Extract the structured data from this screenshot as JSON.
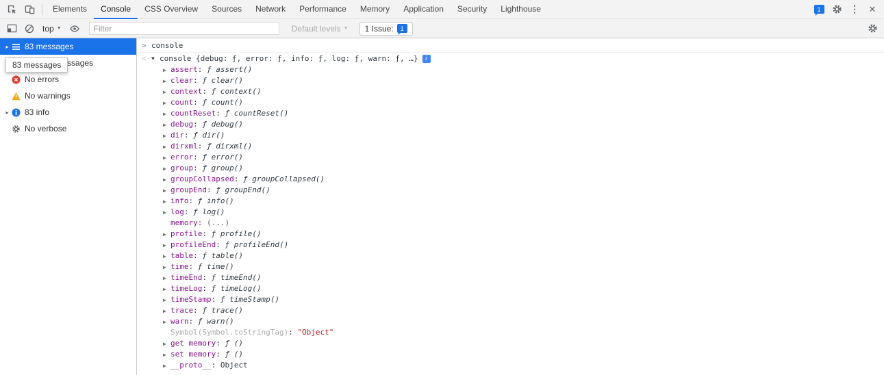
{
  "window": {
    "tabs": [
      "Elements",
      "Console",
      "CSS Overview",
      "Sources",
      "Network",
      "Performance",
      "Memory",
      "Application",
      "Security",
      "Lighthouse"
    ],
    "active_tab": "Console",
    "issues_badge": "1"
  },
  "toolbar": {
    "context": "top",
    "filter_placeholder": "Filter",
    "levels": "Default levels",
    "issue_text": "1 Issue:",
    "issue_count": "1"
  },
  "icons": {
    "inspect": "cursor-in-box",
    "device_toolbar": "phone-tablet",
    "issues": "speech-bubble",
    "settings": "gear",
    "menu": "kebab-dots",
    "close": "x",
    "sidebar_toggle": "panel-square",
    "clear_console": "slashed-circle",
    "live_expression": "eye",
    "messages": "list-lines",
    "user_messages": "person",
    "errors": "red-circle-x",
    "warnings": "yellow-triangle-exclaim",
    "info": "blue-circle-i",
    "verbose": "gear"
  },
  "sidebar": {
    "tooltip": "83 messages",
    "items": [
      {
        "label": "83 messages",
        "icon": "messages",
        "selected": true,
        "expandable": true
      },
      {
        "label": "No user messages",
        "icon": "user_messages"
      },
      {
        "label": "No errors",
        "icon": "errors"
      },
      {
        "label": "No warnings",
        "icon": "warnings"
      },
      {
        "label": "83 info",
        "icon": "info",
        "expandable": true
      },
      {
        "label": "No verbose",
        "icon": "verbose"
      }
    ]
  },
  "console": {
    "command": "console",
    "result": {
      "preview": "console {debug: ƒ, error: ƒ, info: ƒ, log: ƒ, warn: ƒ, …}",
      "expanded": true
    },
    "properties": [
      {
        "name": "assert",
        "value": "ƒ assert()",
        "kind": "function",
        "expandable": true
      },
      {
        "name": "clear",
        "value": "ƒ clear()",
        "kind": "function",
        "expandable": true
      },
      {
        "name": "context",
        "value": "ƒ context()",
        "kind": "function",
        "expandable": true
      },
      {
        "name": "count",
        "value": "ƒ count()",
        "kind": "function",
        "expandable": true
      },
      {
        "name": "countReset",
        "value": "ƒ countReset()",
        "kind": "function",
        "expandable": true
      },
      {
        "name": "debug",
        "value": "ƒ debug()",
        "kind": "function",
        "expandable": true
      },
      {
        "name": "dir",
        "value": "ƒ dir()",
        "kind": "function",
        "expandable": true
      },
      {
        "name": "dirxml",
        "value": "ƒ dirxml()",
        "kind": "function",
        "expandable": true
      },
      {
        "name": "error",
        "value": "ƒ error()",
        "kind": "function",
        "expandable": true
      },
      {
        "name": "group",
        "value": "ƒ group()",
        "kind": "function",
        "expandable": true
      },
      {
        "name": "groupCollapsed",
        "value": "ƒ groupCollapsed()",
        "kind": "function",
        "expandable": true
      },
      {
        "name": "groupEnd",
        "value": "ƒ groupEnd()",
        "kind": "function",
        "expandable": true
      },
      {
        "name": "info",
        "value": "ƒ info()",
        "kind": "function",
        "expandable": true
      },
      {
        "name": "log",
        "value": "ƒ log()",
        "kind": "function",
        "expandable": true
      },
      {
        "name": "memory",
        "value": "(...)",
        "kind": "accessor"
      },
      {
        "name": "profile",
        "value": "ƒ profile()",
        "kind": "function",
        "expandable": true
      },
      {
        "name": "profileEnd",
        "value": "ƒ profileEnd()",
        "kind": "function",
        "expandable": true
      },
      {
        "name": "table",
        "value": "ƒ table()",
        "kind": "function",
        "expandable": true
      },
      {
        "name": "time",
        "value": "ƒ time()",
        "kind": "function",
        "expandable": true
      },
      {
        "name": "timeEnd",
        "value": "ƒ timeEnd()",
        "kind": "function",
        "expandable": true
      },
      {
        "name": "timeLog",
        "value": "ƒ timeLog()",
        "kind": "function",
        "expandable": true
      },
      {
        "name": "timeStamp",
        "value": "ƒ timeStamp()",
        "kind": "function",
        "expandable": true
      },
      {
        "name": "trace",
        "value": "ƒ trace()",
        "kind": "function",
        "expandable": true
      },
      {
        "name": "warn",
        "value": "ƒ warn()",
        "kind": "function",
        "expandable": true
      },
      {
        "name": "Symbol(Symbol.toStringTag)",
        "value": "\"Object\"",
        "kind": "string",
        "dim": true
      },
      {
        "name": "get memory",
        "value": "ƒ ()",
        "kind": "function",
        "expandable": true
      },
      {
        "name": "set memory",
        "value": "ƒ ()",
        "kind": "function",
        "expandable": true
      },
      {
        "name": "__proto__",
        "value": "Object",
        "kind": "object",
        "expandable": true
      }
    ]
  },
  "colors": {
    "accent_blue": "#1a73e8",
    "property_name": "#881391",
    "string_value": "#c41a16",
    "error_red": "#df3a30",
    "warning_yellow": "#f2a60d"
  }
}
